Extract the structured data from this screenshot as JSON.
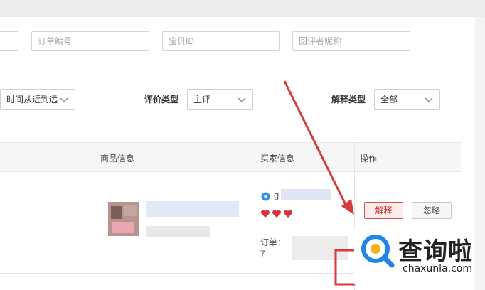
{
  "filters": {
    "order_no_placeholder": "订单编号",
    "item_id_placeholder": "宝贝ID",
    "reviewer_nick_placeholder": "回评者昵称",
    "sort_value": "时间从近到远",
    "rating_type_label": "评价类型",
    "rating_type_value": "主评",
    "explain_type_label": "解释类型",
    "explain_type_value": "全部"
  },
  "table": {
    "columns": [
      "商品信息",
      "买家信息",
      "操作"
    ],
    "row": {
      "buyer_name_prefix": "g",
      "order_label": "订单：",
      "order_digit": "7"
    }
  },
  "actions": {
    "explain_label": "解释",
    "ignore_label": "忽略"
  },
  "watermark": {
    "brand": "查询啦",
    "domain": "chaxunla.com"
  },
  "colors": {
    "accent_red": "#d9534f",
    "arrow_red": "#d63a3a",
    "logo_blue": "#1f86e6"
  }
}
